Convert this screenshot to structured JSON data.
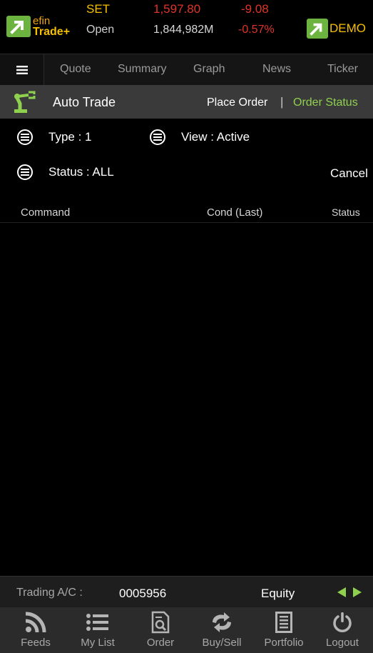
{
  "header": {
    "logo_efin": "efin",
    "logo_trade": "Trade+",
    "market": "SET",
    "open_label": "Open",
    "index": "1,597.80",
    "volume": "1,844,982M",
    "change": "-9.08",
    "change_pct": "-0.57%",
    "demo": "DEMO"
  },
  "tabs": [
    "Quote",
    "Summary",
    "Graph",
    "News",
    "Ticker"
  ],
  "autotrade": {
    "title": "Auto Trade",
    "place_order": "Place Order",
    "separator": "|",
    "order_status": "Order Status"
  },
  "filters": {
    "type": "Type : 1",
    "view": "View : Active",
    "status": "Status : ALL",
    "cancel": "Cancel"
  },
  "columns": {
    "command": "Command",
    "cond": "Cond (Last)",
    "status": "Status"
  },
  "account": {
    "label": "Trading A/C :",
    "number": "0005956",
    "type": "Equity"
  },
  "nav": [
    {
      "label": "Feeds",
      "icon": "rss-icon"
    },
    {
      "label": "My List",
      "icon": "list-icon"
    },
    {
      "label": "Order",
      "icon": "order-search-icon"
    },
    {
      "label": "Buy/Sell",
      "icon": "exchange-icon"
    },
    {
      "label": "Portfolio",
      "icon": "portfolio-icon"
    },
    {
      "label": "Logout",
      "icon": "power-icon"
    }
  ],
  "colors": {
    "accent_green": "#8fd14f",
    "down_red": "#e0332a",
    "market_yellow": "#f5c000",
    "logo_green": "#6cb33f"
  }
}
